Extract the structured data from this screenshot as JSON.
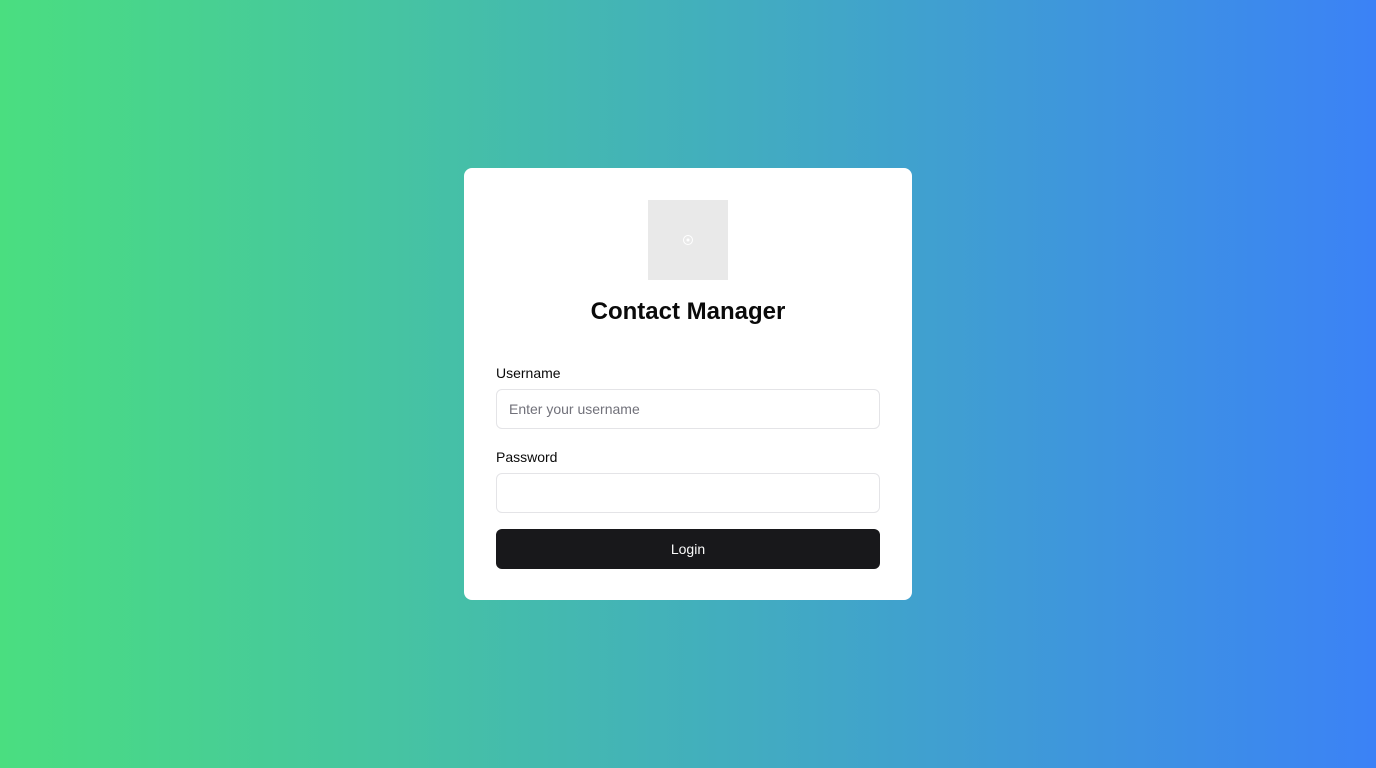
{
  "colors": {
    "background_start": "#4ade80",
    "background_end": "#3b82f6",
    "card": "#ffffff",
    "button": "#18181b",
    "button_text": "#fafafa"
  },
  "logo": {
    "icon": "broken-image-icon"
  },
  "title": "Contact Manager",
  "form": {
    "username": {
      "label": "Username",
      "placeholder": "Enter your username",
      "value": ""
    },
    "password": {
      "label": "Password",
      "placeholder": "",
      "value": ""
    },
    "login_label": "Login"
  }
}
